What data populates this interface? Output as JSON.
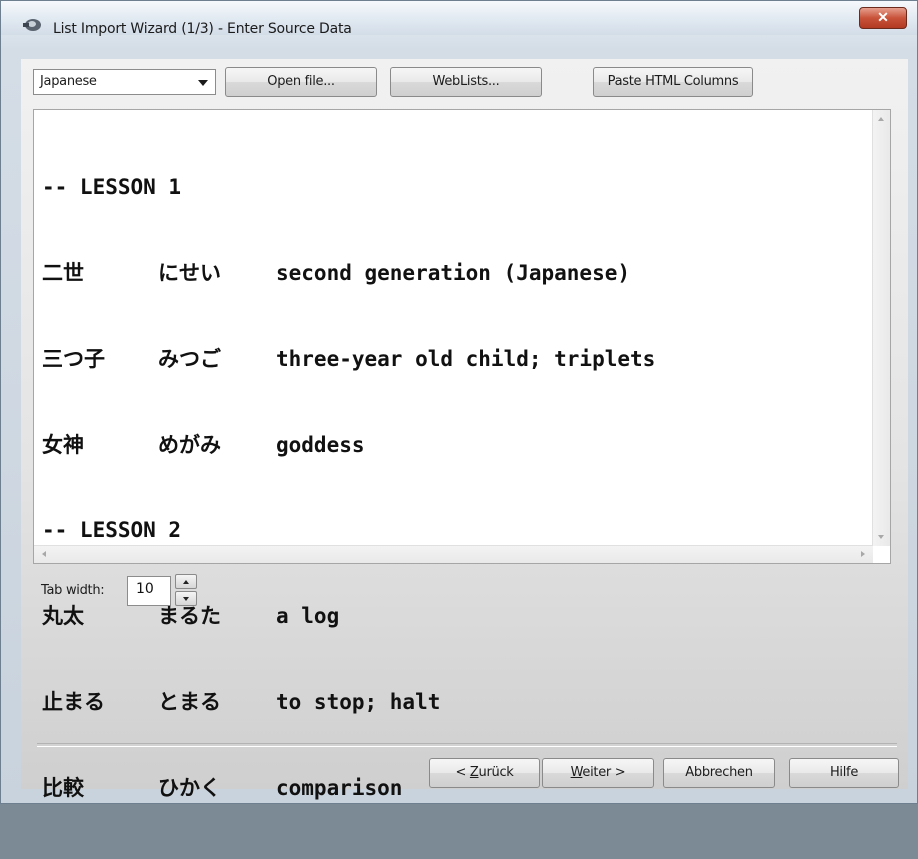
{
  "window": {
    "title": "List Import Wizard (1/3) - Enter Source Data",
    "close_label": "x"
  },
  "toolbar": {
    "language_select": {
      "selected": "Japanese"
    },
    "open_file_label": "Open file...",
    "weblists_label": "WebLists...",
    "paste_html_label": "Paste HTML Columns"
  },
  "editor": {
    "rows": [
      {
        "col1": "-- LESSON 1",
        "col2": "",
        "col3": ""
      },
      {
        "col1": "二世",
        "col2": "にせい",
        "col3": "second generation (Japanese)"
      },
      {
        "col1": "三つ子",
        "col2": "みつご",
        "col3": "three-year old child; triplets"
      },
      {
        "col1": "女神",
        "col2": "めがみ",
        "col3": "goddess"
      },
      {
        "col1": "-- LESSON 2",
        "col2": "",
        "col3": ""
      },
      {
        "col1": "丸太",
        "col2": "まるた",
        "col3": "a log"
      },
      {
        "col1": "止まる",
        "col2": "とまる",
        "col3": "to stop; halt"
      },
      {
        "col1": "比較",
        "col2": "ひかく",
        "col3": "comparison"
      }
    ]
  },
  "tab_width": {
    "label": "Tab width:",
    "value": "10"
  },
  "footer": {
    "back_label": "< Zurück",
    "back_mnemonic": "Z",
    "next_label": "Weiter >",
    "next_mnemonic": "W",
    "cancel_label": "Abbrechen",
    "help_label": "Hilfe"
  },
  "colors": {
    "close_button": "#c8523a",
    "editor_background": "#ffffff",
    "client_background": "#e4e4e4"
  },
  "icons": {
    "app": "app-icon",
    "dropdown": "chevron-down-icon",
    "close": "close-icon"
  }
}
